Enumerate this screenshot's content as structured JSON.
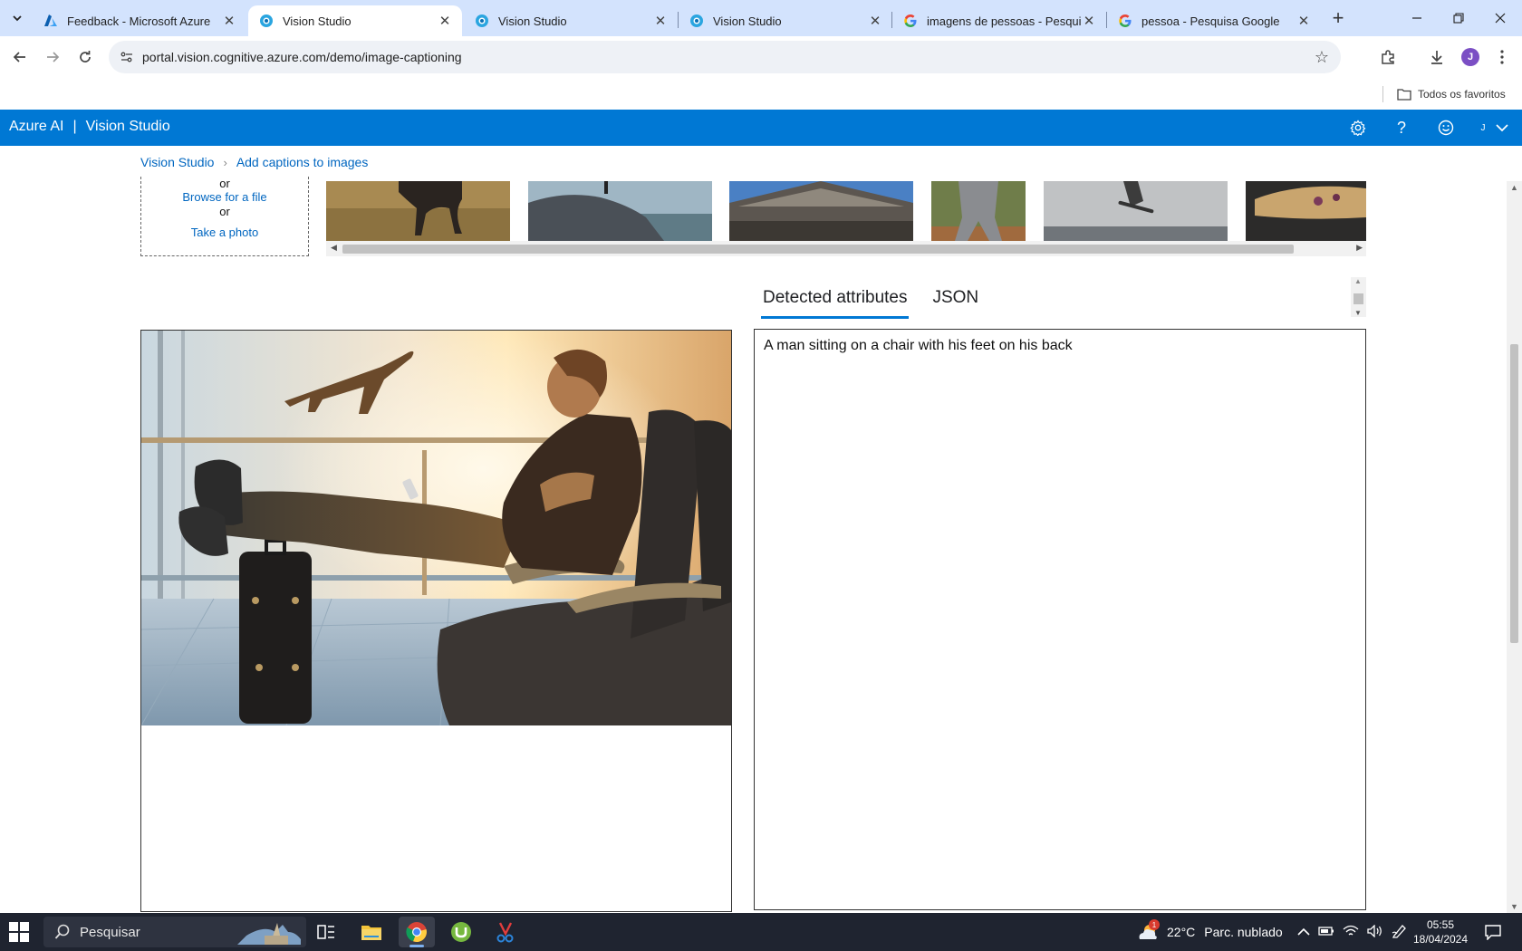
{
  "browser": {
    "tabs": [
      {
        "title": "Feedback - Microsoft Azure",
        "icon": "azure-logo-icon"
      },
      {
        "title": "Vision Studio",
        "icon": "vision-studio-icon",
        "active": true
      },
      {
        "title": "Vision Studio",
        "icon": "vision-studio-icon"
      },
      {
        "title": "Vision Studio",
        "icon": "vision-studio-icon"
      },
      {
        "title": "imagens de pessoas - Pesquisa",
        "icon": "google-icon"
      },
      {
        "title": "pessoa - Pesquisa Google",
        "icon": "google-icon"
      }
    ],
    "url": "portal.vision.cognitive.azure.com/demo/image-captioning",
    "profile_initial": "J",
    "bookmarks_all": "Todos os favoritos"
  },
  "azure_header": {
    "product": "Azure AI",
    "separator": "|",
    "studio": "Vision Studio",
    "user_initial": "J"
  },
  "breadcrumb": {
    "home": "Vision Studio",
    "current": "Add captions to images"
  },
  "upload": {
    "or1": "or",
    "browse": "Browse for a file",
    "or2": "or",
    "take_photo": "Take a photo"
  },
  "results": {
    "tabs": [
      "Detected attributes",
      "JSON"
    ],
    "selected_tab": "Detected attributes",
    "caption": "A man sitting on a chair with his feet on his back"
  },
  "taskbar": {
    "search_placeholder": "Pesquisar",
    "weather_temp": "22°C",
    "weather_desc": "Parc. nublado",
    "time": "05:55",
    "date": "18/04/2024",
    "notification_count": "1"
  },
  "colors": {
    "azure_blue": "#0078d4",
    "tab_strip": "#d3e3fd",
    "link": "#0066c0"
  }
}
